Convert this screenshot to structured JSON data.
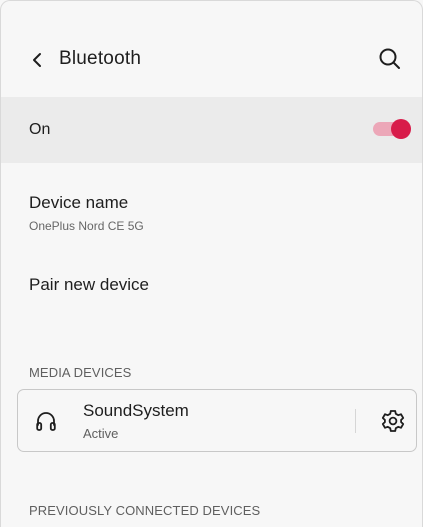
{
  "header": {
    "title": "Bluetooth",
    "back_icon": "chevron-left-icon",
    "search_icon": "search-icon"
  },
  "toggle_row": {
    "label": "On",
    "state": true,
    "accent_color": "#d81b4a",
    "track_color": "#eca7b8"
  },
  "device_name": {
    "label": "Device name",
    "value": "OnePlus Nord CE 5G"
  },
  "pair": {
    "label": "Pair new device"
  },
  "media_section": {
    "header": "MEDIA DEVICES",
    "devices": [
      {
        "name": "SoundSystem",
        "status": "Active",
        "icon": "headphones-icon",
        "settings_icon": "gear-icon"
      }
    ]
  },
  "previous_section": {
    "header": "PREVIOUSLY CONNECTED DEVICES"
  }
}
